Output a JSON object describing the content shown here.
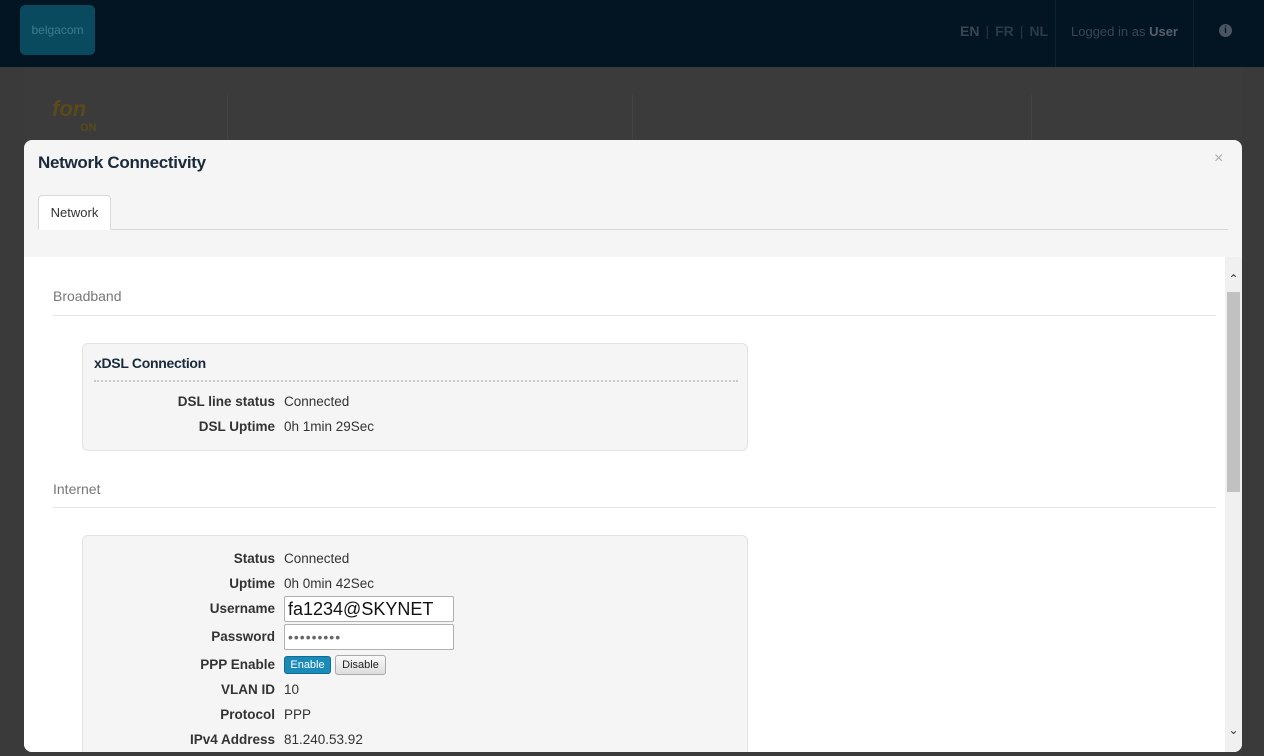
{
  "header": {
    "logo_text": "belgacom",
    "lang_en": "EN",
    "lang_fr": "FR",
    "lang_nl": "NL",
    "logged_in_prefix": "Logged in as",
    "logged_in_user": "User"
  },
  "background": {
    "fon_logo": "fon",
    "fon_on": "ON"
  },
  "modal": {
    "title": "Network Connectivity",
    "close": "×",
    "tab_network": "Network"
  },
  "broadband": {
    "section_title": "Broadband",
    "card_title": "xDSL Connection",
    "rows": [
      {
        "label": "DSL line status",
        "value": "Connected"
      },
      {
        "label": "DSL Uptime",
        "value": "0h 1min 29Sec"
      }
    ]
  },
  "internet": {
    "section_title": "Internet",
    "status_label": "Status",
    "status_value": "Connected",
    "uptime_label": "Uptime",
    "uptime_value": "0h 0min 42Sec",
    "username_label": "Username",
    "username_value": "fa1234@SKYNET",
    "password_label": "Password",
    "password_value": "•••••••••",
    "ppp_label": "PPP Enable",
    "enable_btn": "Enable",
    "disable_btn": "Disable",
    "vlan_label": "VLAN ID",
    "vlan_value": "10",
    "protocol_label": "Protocol",
    "protocol_value": "PPP",
    "ipv4_label": "IPv4 Address",
    "ipv4_value": "81.240.53.92"
  },
  "icons": {
    "info": "i",
    "scroll_up": "⌃",
    "scroll_down": "⌄"
  }
}
